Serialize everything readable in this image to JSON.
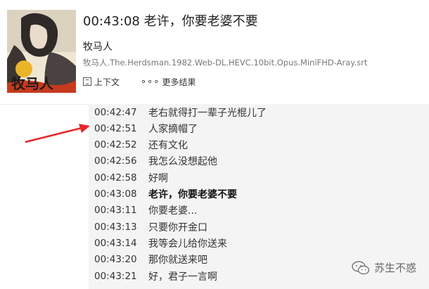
{
  "header": {
    "title": "00:43:08 老许，你要老婆不要",
    "movie": "牧马人",
    "file": "牧马人.The.Herdsman.1982.Web-DL.HEVC.10bit.Opus.MiniFHD-Aray.srt",
    "poster_title": "牧马人",
    "context_label": "上下文",
    "more_label": "更多结果"
  },
  "subtitles": [
    {
      "time": "00:42:47",
      "text": "老右就得打一辈子光棍儿了"
    },
    {
      "time": "00:42:51",
      "text": "人家摘帽了"
    },
    {
      "time": "00:42:52",
      "text": "还有文化"
    },
    {
      "time": "00:42:56",
      "text": "我怎么没想起他"
    },
    {
      "time": "00:42:58",
      "text": "好啊"
    },
    {
      "time": "00:43:08",
      "text": "老许，你要老婆不要"
    },
    {
      "time": "00:43:11",
      "text": "你要老婆..."
    },
    {
      "time": "00:43:13",
      "text": "只要你开金口"
    },
    {
      "time": "00:43:14",
      "text": "我等会儿给你送来"
    },
    {
      "time": "00:43:20",
      "text": "那你就送来吧"
    },
    {
      "time": "00:43:21",
      "text": "好，君子一言啊"
    }
  ],
  "watermark": {
    "text": "苏生不惑"
  },
  "icons": {
    "context": "context-icon",
    "more": "more-dots-icon",
    "arrow": "red-arrow-icon",
    "watermark": "wechat-icon"
  },
  "colors": {
    "arrow": "#e8262b",
    "list_bg": "#f4f4f4"
  }
}
